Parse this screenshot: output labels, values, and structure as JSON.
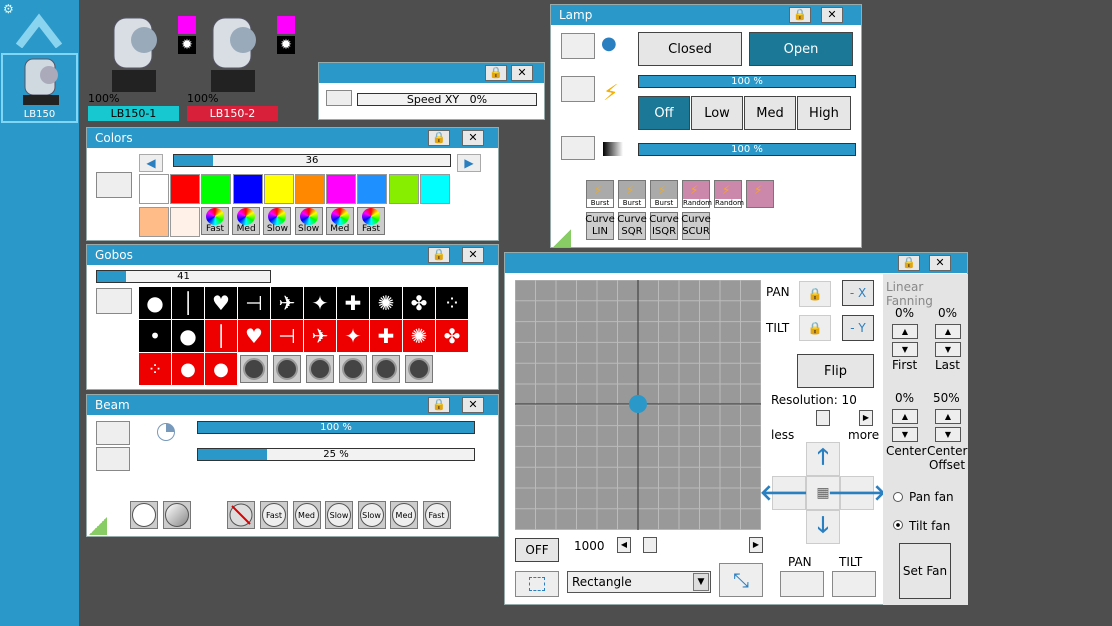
{
  "sidebar": {
    "fixture_label": "LB150"
  },
  "fixtures": [
    {
      "name": "LB150-1",
      "intensity": "100%",
      "color": "#18c8d0"
    },
    {
      "name": "LB150-2",
      "intensity": "100%",
      "color": "#d8203a"
    }
  ],
  "speed": {
    "label": "Speed XY",
    "value": "0%"
  },
  "colors": {
    "title": "Colors",
    "index": "36",
    "index_fill": 0.14,
    "row1": [
      "#ffffff",
      "#ff0000",
      "#00ff00",
      "#0000ff",
      "#ffff00",
      "#ff8800",
      "#ff00ff",
      "#1e90ff",
      "#88ee00",
      "#00ffff"
    ],
    "row2": [
      "#ffbb88",
      "#fff0e8"
    ],
    "wheels": [
      "Fast",
      "Med",
      "Slow",
      "Slow",
      "Med",
      "Fast"
    ]
  },
  "gobos": {
    "title": "Gobos",
    "index": "41",
    "index_fill": 0.17
  },
  "beam": {
    "title": "Beam",
    "bar1": "100 %",
    "bar1_fill": 1.0,
    "bar2": "25 %",
    "bar2_fill": 0.25,
    "speeds": [
      "Fast",
      "Med",
      "Slow",
      "Slow",
      "Med",
      "Fast"
    ]
  },
  "lamp": {
    "title": "Lamp",
    "closed": "Closed",
    "open": "Open",
    "bar1": "100 %",
    "bar2": "100 %",
    "modes": [
      "Off",
      "Low",
      "Med",
      "High"
    ],
    "effects": [
      "Burst",
      "Burst",
      "Burst",
      "Random",
      "Random",
      ""
    ],
    "curves": [
      [
        "Curve",
        "LIN"
      ],
      [
        "Curve",
        "SQR"
      ],
      [
        "Curve",
        "ISQR"
      ],
      [
        "Curve",
        "SCUR"
      ]
    ]
  },
  "position": {
    "pan": "PAN",
    "tilt": "TILT",
    "neg_x": "- X",
    "neg_y": "- Y",
    "flip": "Flip",
    "resolution": "Resolution: 10",
    "less": "less",
    "more": "more",
    "off": "OFF",
    "size": "1000",
    "shape": "Rectangle",
    "pan_lbl": "PAN",
    "tilt_lbl": "TILT"
  },
  "fanning": {
    "title": "Linear Fanning",
    "first_val": "0%",
    "last_val": "0%",
    "first": "First",
    "last": "Last",
    "center_val": "0%",
    "offset_val": "50%",
    "center": "Center",
    "offset_lbl": "Center\nOffset",
    "pan_fan": "Pan fan",
    "tilt_fan": "Tilt fan",
    "set_fan": "Set Fan"
  }
}
